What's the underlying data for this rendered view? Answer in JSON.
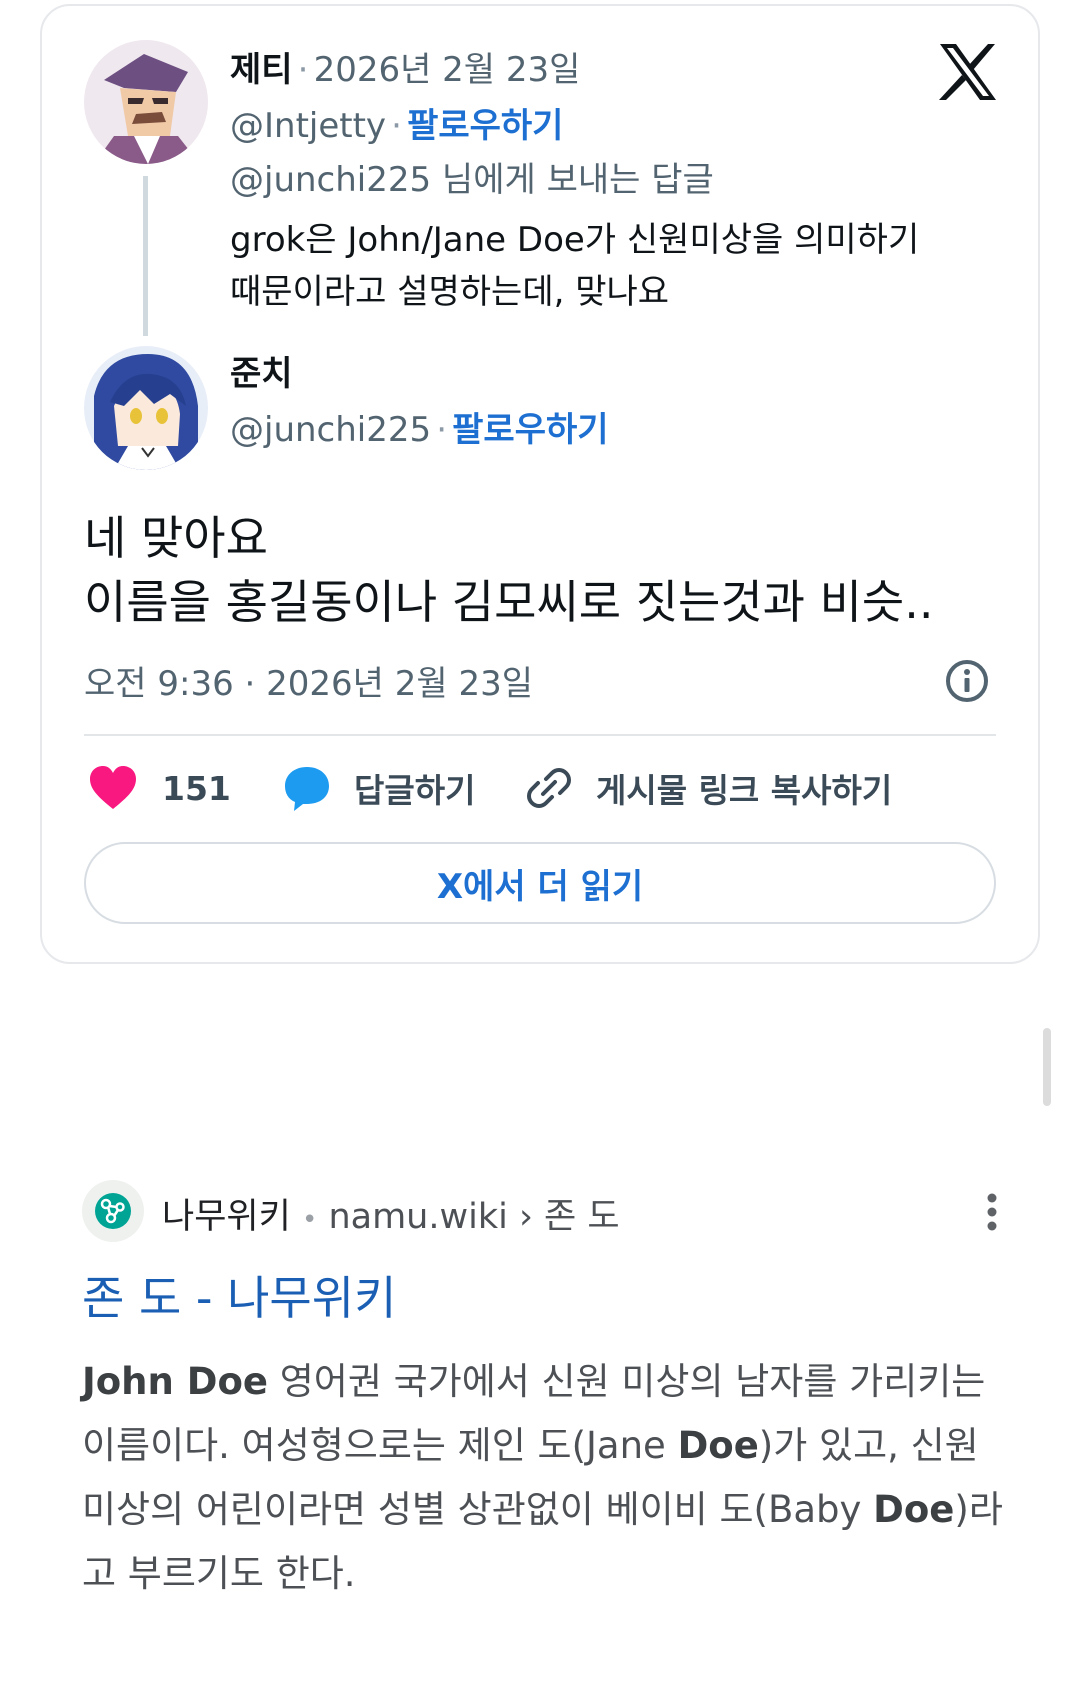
{
  "tweet": {
    "original": {
      "name": "제티",
      "date": "2026년 2월 23일",
      "handle": "@Intjetty",
      "follow_label": "팔로우하기",
      "reply_to": "@junchi225 님에게 보내는 답글",
      "text_line1": "grok은 John/Jane Doe가 신원미상을 의미하기",
      "text_line2": "때문이라고 설명하는데, 맞나요"
    },
    "reply": {
      "name": "준치",
      "handle": "@junchi225",
      "follow_label": "팔로우하기",
      "text_line1": "네 맞아요",
      "text_line2": "이름을 홍길동이나 김모씨로 짓는것과 비슷..",
      "timestamp": "오전 9:36 · 2026년 2월 23일"
    },
    "separator": "·",
    "actions": {
      "like_count": "151",
      "reply_label": "답글하기",
      "copy_link_label": "게시물 링크 복사하기"
    },
    "read_more_label": "X에서 더 읽기"
  },
  "search_result": {
    "site_name": "나무위키",
    "bullet": "•",
    "url_path": "namu.wiki › 존 도",
    "title": "존 도 - 나무위키",
    "snippet": {
      "p1_bold": "John Doe",
      "p1": " 영어권 국가에서 신원 미상의 남자를 가리키는 이름이다. 여성형으로는 제인 도(Jane ",
      "p2_bold": "Doe",
      "p2": ")가 있고, 신원 미상의 어린이라면 성별 상관없이 베이비 도(Baby ",
      "p3_bold": "Doe",
      "p3": ")라고 부르기도 한다."
    }
  },
  "colors": {
    "link_blue": "#1d6fd1",
    "like_pink": "#f91880",
    "reply_blue": "#1d9bf0",
    "result_title": "#1a5fb4"
  },
  "icons": [
    "x-logo-icon",
    "info-icon",
    "heart-icon",
    "comment-icon",
    "link-icon",
    "namuwiki-favicon-icon",
    "more-vert-icon"
  ]
}
